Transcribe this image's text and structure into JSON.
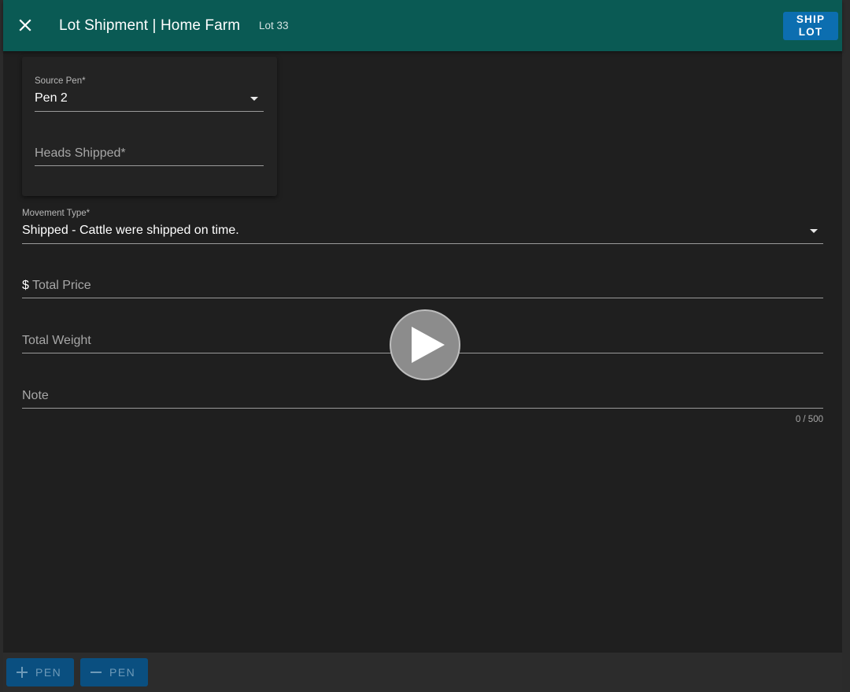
{
  "toolbar": {
    "title": "Lot Shipment | Home Farm",
    "subtitle": "Lot 33",
    "ship_label": "SHIP LOT",
    "close_icon": "close-icon"
  },
  "pen_card": {
    "source_pen": {
      "label": "Source Pen*",
      "value": "Pen 2"
    },
    "heads_shipped": {
      "placeholder": "Heads Shipped*",
      "value": ""
    }
  },
  "form": {
    "movement_type": {
      "label": "Movement Type*",
      "value": "Shipped - Cattle were shipped on time."
    },
    "total_price": {
      "prefix": "$",
      "placeholder": "Total Price",
      "value": ""
    },
    "total_weight": {
      "placeholder": "Total Weight",
      "value": ""
    },
    "note": {
      "placeholder": "Note",
      "value": "",
      "counter": "0 / 500"
    }
  },
  "overlay": {
    "play_icon": "play-icon"
  },
  "footer": {
    "add_pen_label": "PEN",
    "remove_pen_label": "PEN",
    "add_icon": "plus-icon",
    "remove_icon": "minus-icon"
  },
  "colors": {
    "toolbar": "#0a5a54",
    "primary_button": "#0c6eb0",
    "background": "#1f1f1f"
  }
}
